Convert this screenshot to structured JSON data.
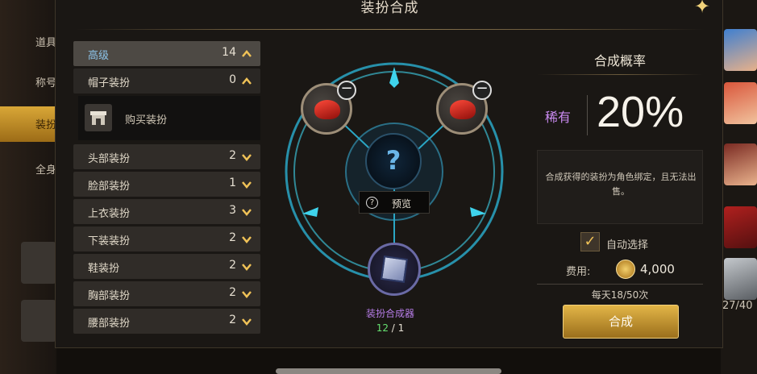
{
  "background": {
    "left_menu": [
      "道具",
      "称号",
      "装扮",
      "全身"
    ],
    "right_count": "27/40"
  },
  "dialog": {
    "title": "装扮合成"
  },
  "categories": {
    "top": {
      "label": "高级",
      "count": "14"
    },
    "hat": {
      "label": "帽子装扮",
      "count": "0"
    },
    "buy": {
      "label": "购买装扮"
    },
    "items": [
      {
        "label": "头部装扮",
        "count": "2"
      },
      {
        "label": "脸部装扮",
        "count": "1"
      },
      {
        "label": "上衣装扮",
        "count": "3"
      },
      {
        "label": "下装装扮",
        "count": "2"
      },
      {
        "label": "鞋装扮",
        "count": "2"
      },
      {
        "label": "胸部装扮",
        "count": "2"
      },
      {
        "label": "腰部装扮",
        "count": "2"
      }
    ]
  },
  "synth": {
    "center_symbol": "?",
    "preview_label": "预览",
    "synthesizer_name": "装扮合成器",
    "count_have": "12",
    "count_need": "1"
  },
  "rate": {
    "title": "合成概率",
    "rarity": "稀有",
    "value": "20%",
    "description": "合成获得的装扮为角色绑定，且无法出售。",
    "auto_select_label": "自动选择",
    "fee_label": "费用:",
    "fee_value": "4,000",
    "daily": "每天18/50次",
    "combine_button": "合成"
  },
  "colors": {
    "accent_gold": "#e2b547",
    "rarity_purple": "#c98af0",
    "cyan_ring": "#3fd3ec"
  }
}
